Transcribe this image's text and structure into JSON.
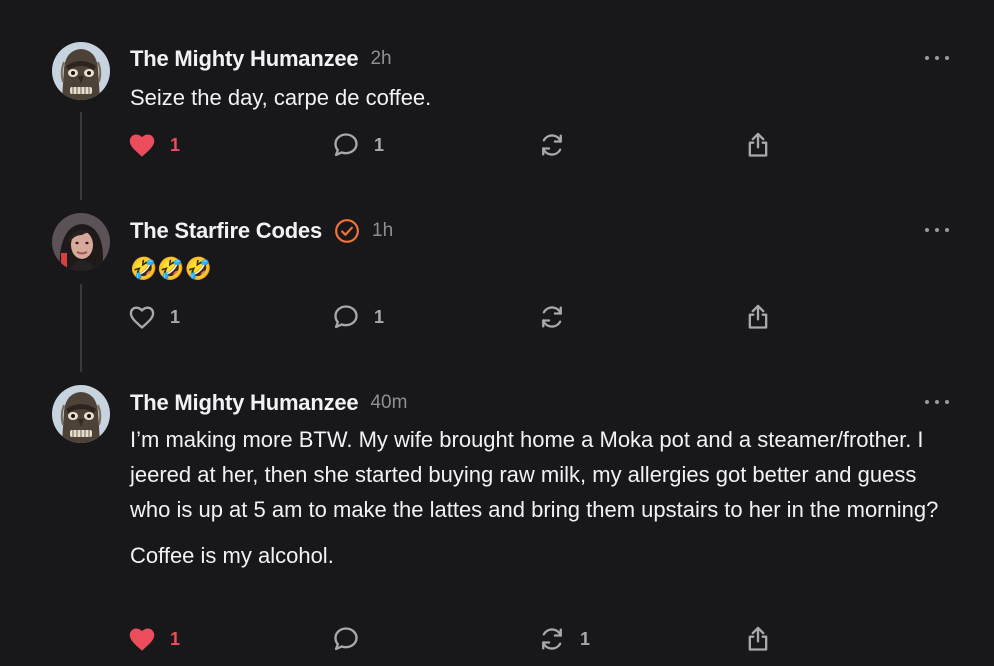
{
  "colors": {
    "background": "#18181a",
    "like_active": "#ec4d5d",
    "verified_badge": "#f0733a",
    "icon": "#a8a8ae"
  },
  "posts": [
    {
      "author": "The Mighty Humanzee",
      "time": "2h",
      "verified": false,
      "avatar": "tiki-mask-avatar",
      "body": [
        "Seize the day, carpe de coffee."
      ],
      "liked": true,
      "likes": "1",
      "replies": "1",
      "reposts": "",
      "share": ""
    },
    {
      "author": "The Starfire Codes",
      "time": "1h",
      "verified": true,
      "avatar": "woman-portrait-avatar",
      "body": [
        "🤣🤣🤣"
      ],
      "liked": false,
      "likes": "1",
      "replies": "1",
      "reposts": "",
      "share": ""
    },
    {
      "author": "The Mighty Humanzee",
      "time": "40m",
      "verified": false,
      "avatar": "tiki-mask-avatar",
      "body": [
        "I’m making more BTW. My wife brought home a Moka pot and a steamer/frother. I jeered at her, then she started buying raw milk, my allergies got better and guess who is up at 5 am to make the lattes and bring them upstairs to her in the morning?",
        "Coffee is my alcohol."
      ],
      "liked": true,
      "likes": "1",
      "replies": "",
      "reposts": "1",
      "share": ""
    }
  ]
}
